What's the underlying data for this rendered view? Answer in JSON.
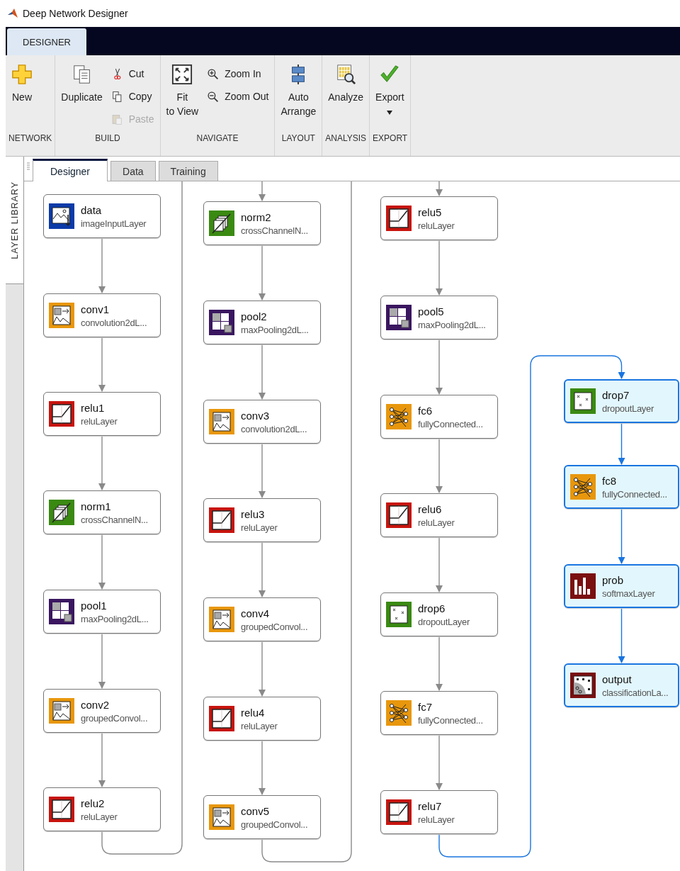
{
  "window": {
    "title": "Deep Network Designer"
  },
  "ribbon_tabs": [
    {
      "label": "DESIGNER",
      "selected": true
    }
  ],
  "ribbon": [
    {
      "label": "NETWORK",
      "items": [
        {
          "kind": "large",
          "label": "New",
          "disabled": false
        }
      ]
    },
    {
      "label": "BUILD",
      "items": [
        {
          "kind": "large",
          "label": "Duplicate",
          "disabled": false
        },
        {
          "kind": "small",
          "label": "Cut",
          "disabled": false
        },
        {
          "kind": "small",
          "label": "Copy",
          "disabled": false
        },
        {
          "kind": "small",
          "label": "Paste",
          "disabled": true
        }
      ]
    },
    {
      "label": "NAVIGATE",
      "items": [
        {
          "kind": "large",
          "label": "Fit\nto View",
          "disabled": false
        },
        {
          "kind": "small",
          "label": "Zoom In",
          "disabled": false
        },
        {
          "kind": "small",
          "label": "Zoom Out",
          "disabled": false
        }
      ]
    },
    {
      "label": "LAYOUT",
      "items": [
        {
          "kind": "large",
          "label": "Auto\nArrange",
          "disabled": false
        }
      ]
    },
    {
      "label": "ANALYSIS",
      "items": [
        {
          "kind": "large",
          "label": "Analyze",
          "disabled": false
        }
      ]
    },
    {
      "label": "EXPORT",
      "items": [
        {
          "kind": "large",
          "label": "Export",
          "disabled": false,
          "dropdown": true
        }
      ]
    }
  ],
  "side_panel": {
    "label": "LAYER LIBRARY"
  },
  "doc_tabs": [
    {
      "label": "Designer",
      "selected": true
    },
    {
      "label": "Data",
      "selected": false
    },
    {
      "label": "Training",
      "selected": false
    }
  ],
  "columns": [
    [
      {
        "name": "data",
        "type": "imageInputLayer",
        "kind": "input",
        "selected": false
      },
      {
        "name": "conv1",
        "type": "convolution2dL...",
        "kind": "conv",
        "selected": false
      },
      {
        "name": "relu1",
        "type": "reluLayer",
        "kind": "relu",
        "selected": false
      },
      {
        "name": "norm1",
        "type": "crossChannelN...",
        "kind": "norm",
        "selected": false
      },
      {
        "name": "pool1",
        "type": "maxPooling2dL...",
        "kind": "pool",
        "selected": false
      },
      {
        "name": "conv2",
        "type": "groupedConvol...",
        "kind": "conv",
        "selected": false
      },
      {
        "name": "relu2",
        "type": "reluLayer",
        "kind": "relu",
        "selected": false
      }
    ],
    [
      {
        "name": "norm2",
        "type": "crossChannelN...",
        "kind": "norm",
        "selected": false
      },
      {
        "name": "pool2",
        "type": "maxPooling2dL...",
        "kind": "pool",
        "selected": false
      },
      {
        "name": "conv3",
        "type": "convolution2dL...",
        "kind": "conv",
        "selected": false
      },
      {
        "name": "relu3",
        "type": "reluLayer",
        "kind": "relu",
        "selected": false
      },
      {
        "name": "conv4",
        "type": "groupedConvol...",
        "kind": "conv",
        "selected": false
      },
      {
        "name": "relu4",
        "type": "reluLayer",
        "kind": "relu",
        "selected": false
      },
      {
        "name": "conv5",
        "type": "groupedConvol...",
        "kind": "conv",
        "selected": false
      }
    ],
    [
      {
        "name": "relu5",
        "type": "reluLayer",
        "kind": "relu",
        "selected": false
      },
      {
        "name": "pool5",
        "type": "maxPooling2dL...",
        "kind": "pool",
        "selected": false
      },
      {
        "name": "fc6",
        "type": "fullyConnected...",
        "kind": "fc",
        "selected": false
      },
      {
        "name": "relu6",
        "type": "reluLayer",
        "kind": "relu",
        "selected": false
      },
      {
        "name": "drop6",
        "type": "dropoutLayer",
        "kind": "dropout",
        "selected": false
      },
      {
        "name": "fc7",
        "type": "fullyConnected...",
        "kind": "fc",
        "selected": false
      },
      {
        "name": "relu7",
        "type": "reluLayer",
        "kind": "relu",
        "selected": false
      }
    ],
    [
      {
        "name": "drop7",
        "type": "dropoutLayer",
        "kind": "dropout",
        "selected": true
      },
      {
        "name": "fc8",
        "type": "fullyConnected...",
        "kind": "fc",
        "selected": true
      },
      {
        "name": "prob",
        "type": "softmaxLayer",
        "kind": "softmax",
        "selected": true
      },
      {
        "name": "output",
        "type": "classificationLa...",
        "kind": "classification",
        "selected": true
      }
    ]
  ]
}
